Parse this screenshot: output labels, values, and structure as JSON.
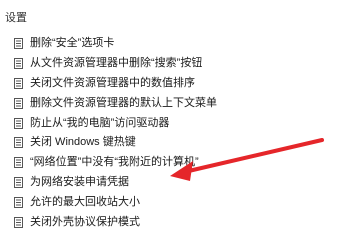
{
  "header": {
    "title": "设置"
  },
  "settings": {
    "items": [
      {
        "label": "删除“安全”选项卡"
      },
      {
        "label": "从文件资源管理器中删除“搜索”按钮"
      },
      {
        "label": "关闭文件资源管理器中的数值排序"
      },
      {
        "label": "删除文件资源管理器的默认上下文菜单"
      },
      {
        "label": "防止从“我的电脑”访问驱动器"
      },
      {
        "label": "关闭 Windows 键热键"
      },
      {
        "label": "“网络位置”中没有“我附近的计算机”"
      },
      {
        "label": "为网络安装申请凭据"
      },
      {
        "label": "允许的最大回收站大小"
      },
      {
        "label": "关闭外壳协议保护模式"
      }
    ]
  },
  "annotation": {
    "arrow_color": "#e5262a",
    "points_to": "关闭 Windows 键热键"
  },
  "icons": {
    "policy_item": "policy-setting-icon"
  }
}
